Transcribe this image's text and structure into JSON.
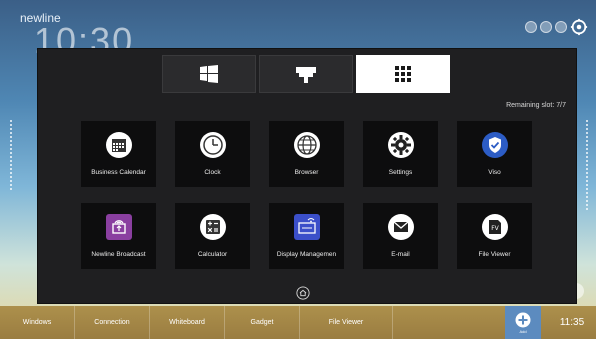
{
  "brand": "newline",
  "clock_big": "10:30",
  "panel": {
    "remaining": "Remaining slot: 7/7",
    "tabs": [
      {
        "name": "windows",
        "icon": "windows-logo-icon",
        "active": false
      },
      {
        "name": "connection",
        "icon": "hdmi-connector-icon",
        "active": false
      },
      {
        "name": "apps",
        "icon": "app-grid-icon",
        "active": true
      }
    ],
    "apps": [
      {
        "label": "Business Calendar",
        "icon": "calendar-icon"
      },
      {
        "label": "Clock",
        "icon": "clock-icon"
      },
      {
        "label": "Browser",
        "icon": "globe-icon"
      },
      {
        "label": "Settings",
        "icon": "gear-icon"
      },
      {
        "label": "Viso",
        "icon": "shield-check-icon"
      },
      {
        "label": "Newline Broadcast",
        "icon": "broadcast-icon"
      },
      {
        "label": "Calculator",
        "icon": "calculator-icon"
      },
      {
        "label": "Display Managemen",
        "icon": "display-management-icon"
      },
      {
        "label": "E-mail",
        "icon": "mail-icon"
      },
      {
        "label": "File Viewer",
        "icon": "file-viewer-icon"
      }
    ]
  },
  "taskbar": {
    "items": [
      "Windows",
      "Connection",
      "Whiteboard",
      "Gadget",
      "File Viewer"
    ],
    "add_label": "Add",
    "time": "11:35"
  },
  "colors": {
    "accent_purple": "#8a3fa0",
    "accent_blue": "#2c5cc5",
    "taskbar": "#a98e48"
  }
}
